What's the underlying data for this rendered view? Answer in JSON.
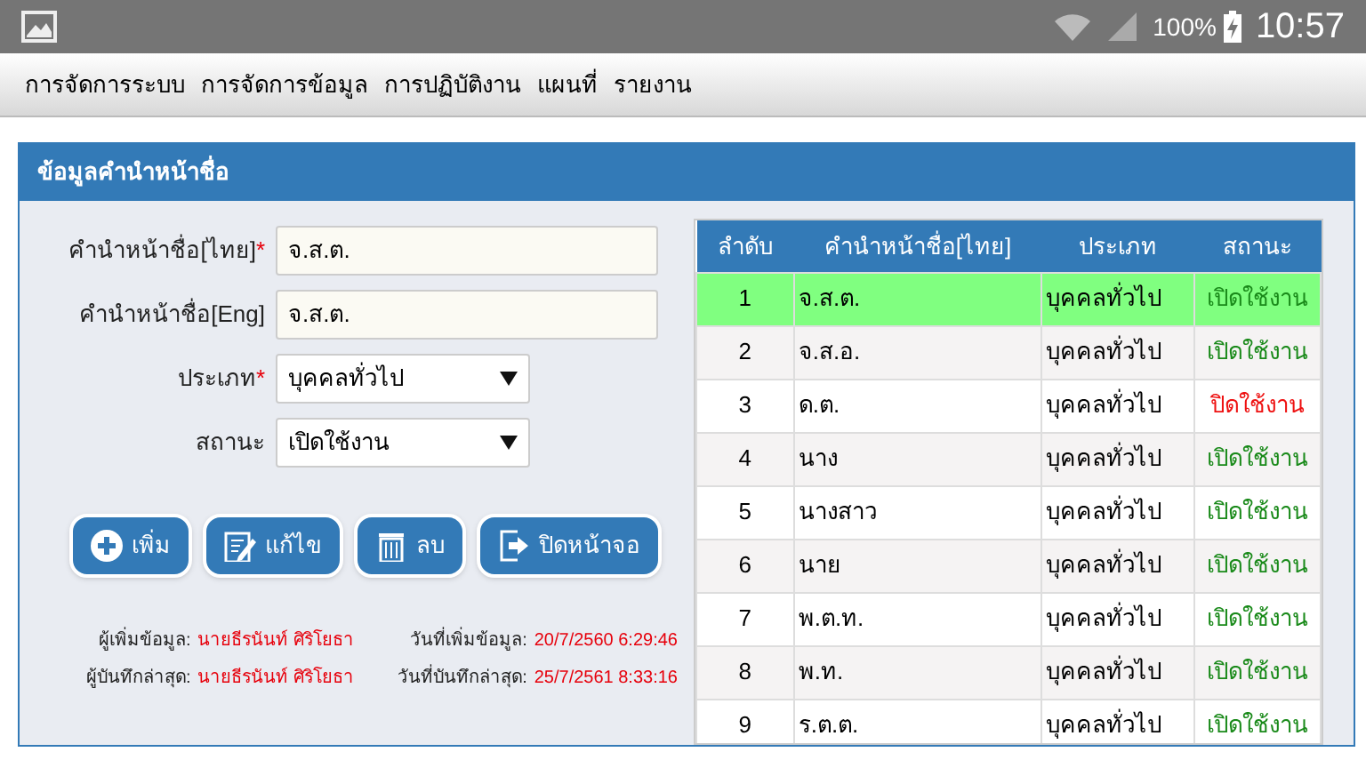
{
  "status_bar": {
    "battery": "100%",
    "time": "10:57"
  },
  "menu": [
    "การจัดการระบบ",
    "การจัดการข้อมูล",
    "การปฏิบัติงาน",
    "แผนที่",
    "รายงาน"
  ],
  "panel": {
    "title": "ข้อมูลคำนำหน้าชื่อ"
  },
  "form": {
    "fields": [
      {
        "kind": "text",
        "label": "คำนำหน้าชื่อ[ไทย]",
        "marker": "*",
        "value": "จ.ส.ต."
      },
      {
        "kind": "text",
        "label": "คำนำหน้าชื่อ[Eng]",
        "value": "จ.ส.ต."
      },
      {
        "kind": "select",
        "label": "ประเภท",
        "marker": "*",
        "value": "บุคคลทั่วไป"
      },
      {
        "kind": "select",
        "label": "สถานะ",
        "value": "เปิดใช้งาน"
      }
    ],
    "buttons": [
      {
        "kind": "add",
        "label": "เพิ่ม"
      },
      {
        "kind": "edit",
        "label": "แก้ไข"
      },
      {
        "kind": "delete",
        "label": "ลบ"
      },
      {
        "kind": "close",
        "label": "ปิดหน้าจอ"
      }
    ],
    "info": [
      {
        "label": "ผู้เพิ่มข้อมูล:",
        "value": "นายธีรนันท์ ศิริโยธา",
        "date_label": "วันที่เพิ่มข้อมูล:",
        "date": "20/7/2560 6:29:46"
      },
      {
        "label": "ผู้บันทึกล่าสุด:",
        "value": "นายธีรนันท์ ศิริโยธา",
        "date_label": "วันที่บันทึกล่าสุด:",
        "date": "25/7/2561 8:33:16"
      }
    ]
  },
  "table": {
    "columns": [
      "ลำดับ",
      "คำนำหน้าชื่อ[ไทย]",
      "ประเภท",
      "สถานะ"
    ],
    "rows": [
      {
        "no": "1",
        "prefix": "จ.ส.ต.",
        "type": "บุคคลทั่วไป",
        "status": "เปิดใช้งาน",
        "enabled": true,
        "selected": true
      },
      {
        "no": "2",
        "prefix": "จ.ส.อ.",
        "type": "บุคคลทั่วไป",
        "status": "เปิดใช้งาน",
        "enabled": true,
        "selected": false
      },
      {
        "no": "3",
        "prefix": "ด.ต.",
        "type": "บุคคลทั่วไป",
        "status": "ปิดใช้งาน",
        "enabled": false,
        "selected": false
      },
      {
        "no": "4",
        "prefix": "นาง",
        "type": "บุคคลทั่วไป",
        "status": "เปิดใช้งาน",
        "enabled": true,
        "selected": false
      },
      {
        "no": "5",
        "prefix": "นางสาว",
        "type": "บุคคลทั่วไป",
        "status": "เปิดใช้งาน",
        "enabled": true,
        "selected": false
      },
      {
        "no": "6",
        "prefix": "นาย",
        "type": "บุคคลทั่วไป",
        "status": "เปิดใช้งาน",
        "enabled": true,
        "selected": false
      },
      {
        "no": "7",
        "prefix": "พ.ต.ท.",
        "type": "บุคคลทั่วไป",
        "status": "เปิดใช้งาน",
        "enabled": true,
        "selected": false
      },
      {
        "no": "8",
        "prefix": "พ.ท.",
        "type": "บุคคลทั่วไป",
        "status": "เปิดใช้งาน",
        "enabled": true,
        "selected": false
      },
      {
        "no": "9",
        "prefix": "ร.ต.ต.",
        "type": "บุคคลทั่วไป",
        "status": "เปิดใช้งาน",
        "enabled": true,
        "selected": false
      }
    ]
  }
}
